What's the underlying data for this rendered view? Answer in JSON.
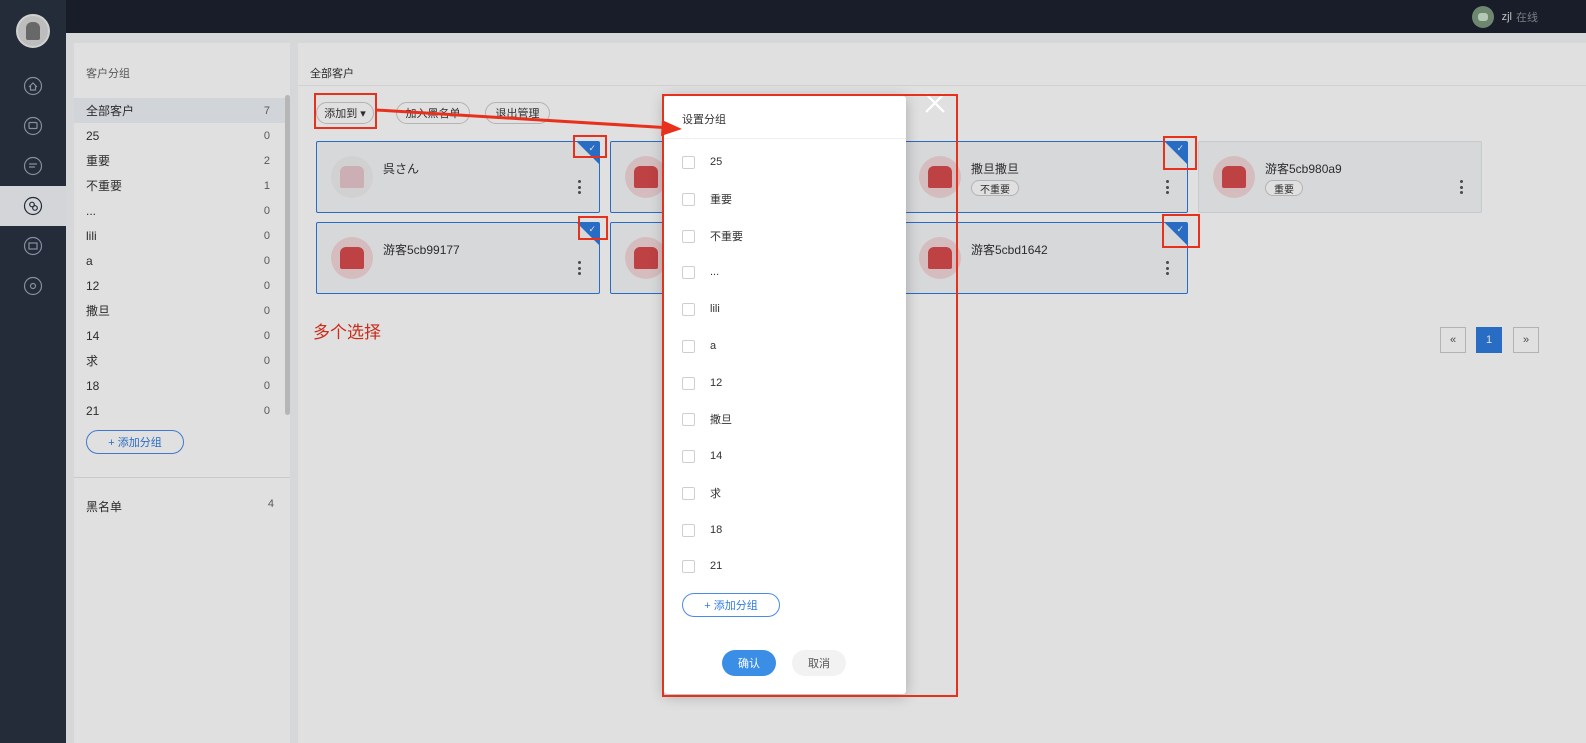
{
  "header": {
    "user_name": "zjl",
    "user_status": "在线"
  },
  "sidebar": {
    "items": [
      {
        "icon": "home-icon"
      },
      {
        "icon": "chat-icon"
      },
      {
        "icon": "message-icon"
      },
      {
        "icon": "customers-icon",
        "active": true
      },
      {
        "icon": "store-icon"
      },
      {
        "icon": "settings-icon"
      }
    ]
  },
  "groups": {
    "title": "客户分组",
    "items": [
      {
        "label": "全部客户",
        "count": "7"
      },
      {
        "label": "25",
        "count": "0"
      },
      {
        "label": "重要",
        "count": "2"
      },
      {
        "label": "不重要",
        "count": "1"
      },
      {
        "label": "...",
        "count": "0"
      },
      {
        "label": "lili",
        "count": "0"
      },
      {
        "label": "a",
        "count": "0"
      },
      {
        "label": "12",
        "count": "0"
      },
      {
        "label": "撒旦",
        "count": "0"
      },
      {
        "label": "14",
        "count": "0"
      },
      {
        "label": "求",
        "count": "0"
      },
      {
        "label": "18",
        "count": "0"
      },
      {
        "label": "21",
        "count": "0"
      }
    ],
    "add_label": "+ 添加分组",
    "blacklist_label": "黑名单",
    "blacklist_count": "4"
  },
  "content": {
    "title": "全部客户",
    "toolbar": {
      "add_to": "添加到 ▾",
      "join_blacklist": "加入黑名单",
      "exit_manage": "退出管理"
    },
    "cards": [
      {
        "name": "呉さん",
        "tag": ""
      },
      {
        "name": "撒旦撒旦",
        "tag": "不重要"
      },
      {
        "name": "游客5cb980a9",
        "tag": "重要"
      },
      {
        "name": "游客5cb99177",
        "tag": ""
      },
      {
        "name": "游客5cbd1642",
        "tag": ""
      }
    ],
    "annotation": "多个选择",
    "pager": {
      "prev": "«",
      "current": "1",
      "next": "»"
    }
  },
  "dialog": {
    "title": "设置分组",
    "options": [
      "25",
      "重要",
      "不重要",
      "...",
      "lili",
      "a",
      "12",
      "撒旦",
      "14",
      "求",
      "18",
      "21"
    ],
    "add_label": "+ 添加分组",
    "confirm": "确认",
    "cancel": "取消"
  },
  "colors": {
    "accent": "#2f7be0",
    "annotation": "#e8311d",
    "sidebar": "#2a3141"
  }
}
